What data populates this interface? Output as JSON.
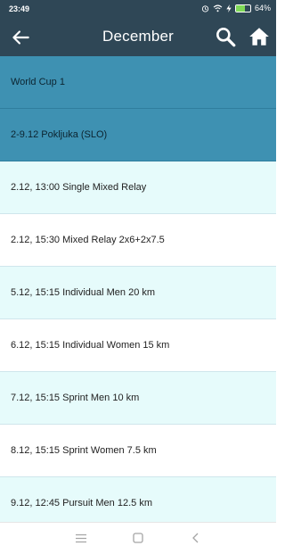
{
  "status_bar": {
    "time": "23:49",
    "battery": "64%",
    "battery_level": 0.64
  },
  "app_bar": {
    "title": "December",
    "back_icon": "arrow-left-icon",
    "search_icon": "search-icon",
    "home_icon": "home-icon"
  },
  "list": [
    {
      "text": "World Cup 1",
      "kind": "group"
    },
    {
      "text": "2-9.12 Pokljuka (SLO)",
      "kind": "group"
    },
    {
      "text": "2.12, 13:00 Single Mixed Relay",
      "kind": "alt"
    },
    {
      "text": "2.12, 15:30 Mixed Relay 2x6+2x7.5",
      "kind": "white"
    },
    {
      "text": "5.12, 15:15 Individual Men 20 km",
      "kind": "alt"
    },
    {
      "text": "6.12, 15:15 Individual Women 15 km",
      "kind": "white"
    },
    {
      "text": "7.12, 15:15 Sprint Men 10 km",
      "kind": "alt"
    },
    {
      "text": "8.12, 15:15 Sprint Women 7.5 km",
      "kind": "white"
    },
    {
      "text": "9.12, 12:45 Pursuit Men 12.5 km",
      "kind": "alt"
    }
  ],
  "colors": {
    "app_bar": "#2f4756",
    "group_row": "#3e91b2",
    "alt_row": "#e6fbfb"
  }
}
